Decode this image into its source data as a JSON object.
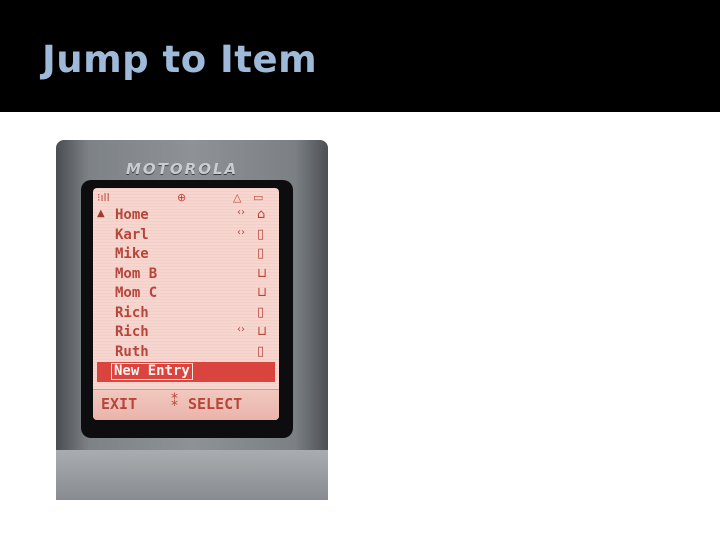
{
  "slide": {
    "title": "Jump to Item"
  },
  "phone": {
    "brand": "MOTOROLA",
    "status_icons": {
      "signal": "signal-icon",
      "phonebook": "phonebook-icon",
      "alert": "alert-icon",
      "battery": "battery-icon"
    },
    "contacts": [
      {
        "name": "Home",
        "ring": true,
        "type_icon": "house-icon"
      },
      {
        "name": "Karl",
        "ring": true,
        "type_icon": "mobile-icon"
      },
      {
        "name": "Mike",
        "ring": false,
        "type_icon": "mobile-icon"
      },
      {
        "name": "Mom B",
        "ring": false,
        "type_icon": "work-icon"
      },
      {
        "name": "Mom C",
        "ring": false,
        "type_icon": "work-icon"
      },
      {
        "name": "Rich",
        "ring": false,
        "type_icon": "mobile-icon"
      },
      {
        "name": "Rich",
        "ring": true,
        "type_icon": "work-icon"
      },
      {
        "name": "Ruth",
        "ring": false,
        "type_icon": "mobile-icon"
      },
      {
        "name": "New Entry",
        "ring": false,
        "type_icon": "",
        "selected": true
      }
    ],
    "softkeys": {
      "left": "EXIT",
      "right": "SELECT"
    },
    "colors": {
      "screen": "#f6d6cf",
      "text": "#b8453a",
      "highlight": "#d9453e"
    }
  }
}
